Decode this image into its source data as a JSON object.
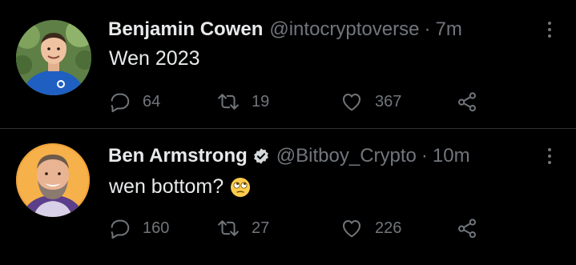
{
  "tweets": [
    {
      "display_name": "Benjamin Cowen",
      "handle": "@intocryptoverse",
      "separator": "·",
      "time": "7m",
      "text": "Wen 2023",
      "replies": "64",
      "retweets": "19",
      "likes": "367",
      "verified": false,
      "avatar": "man-in-blue-shirt-avatar"
    },
    {
      "display_name": "Ben Armstrong",
      "handle": "@Bitboy_Crypto",
      "separator": "·",
      "time": "10m",
      "text": "wen bottom?",
      "emoji": "face-with-rolling-eyes",
      "replies": "160",
      "retweets": "27",
      "likes": "226",
      "verified": true,
      "avatar": "bearded-man-orange-background-avatar"
    }
  ],
  "icons": {
    "reply": "reply-icon",
    "retweet": "retweet-icon",
    "like": "heart-icon",
    "share": "share-icon",
    "more": "more-options-icon",
    "verified": "verified-badge-icon"
  },
  "colors": {
    "background": "#000000",
    "text_primary": "#e7e9ea",
    "text_secondary": "#71767b",
    "divider": "#2f3336"
  }
}
